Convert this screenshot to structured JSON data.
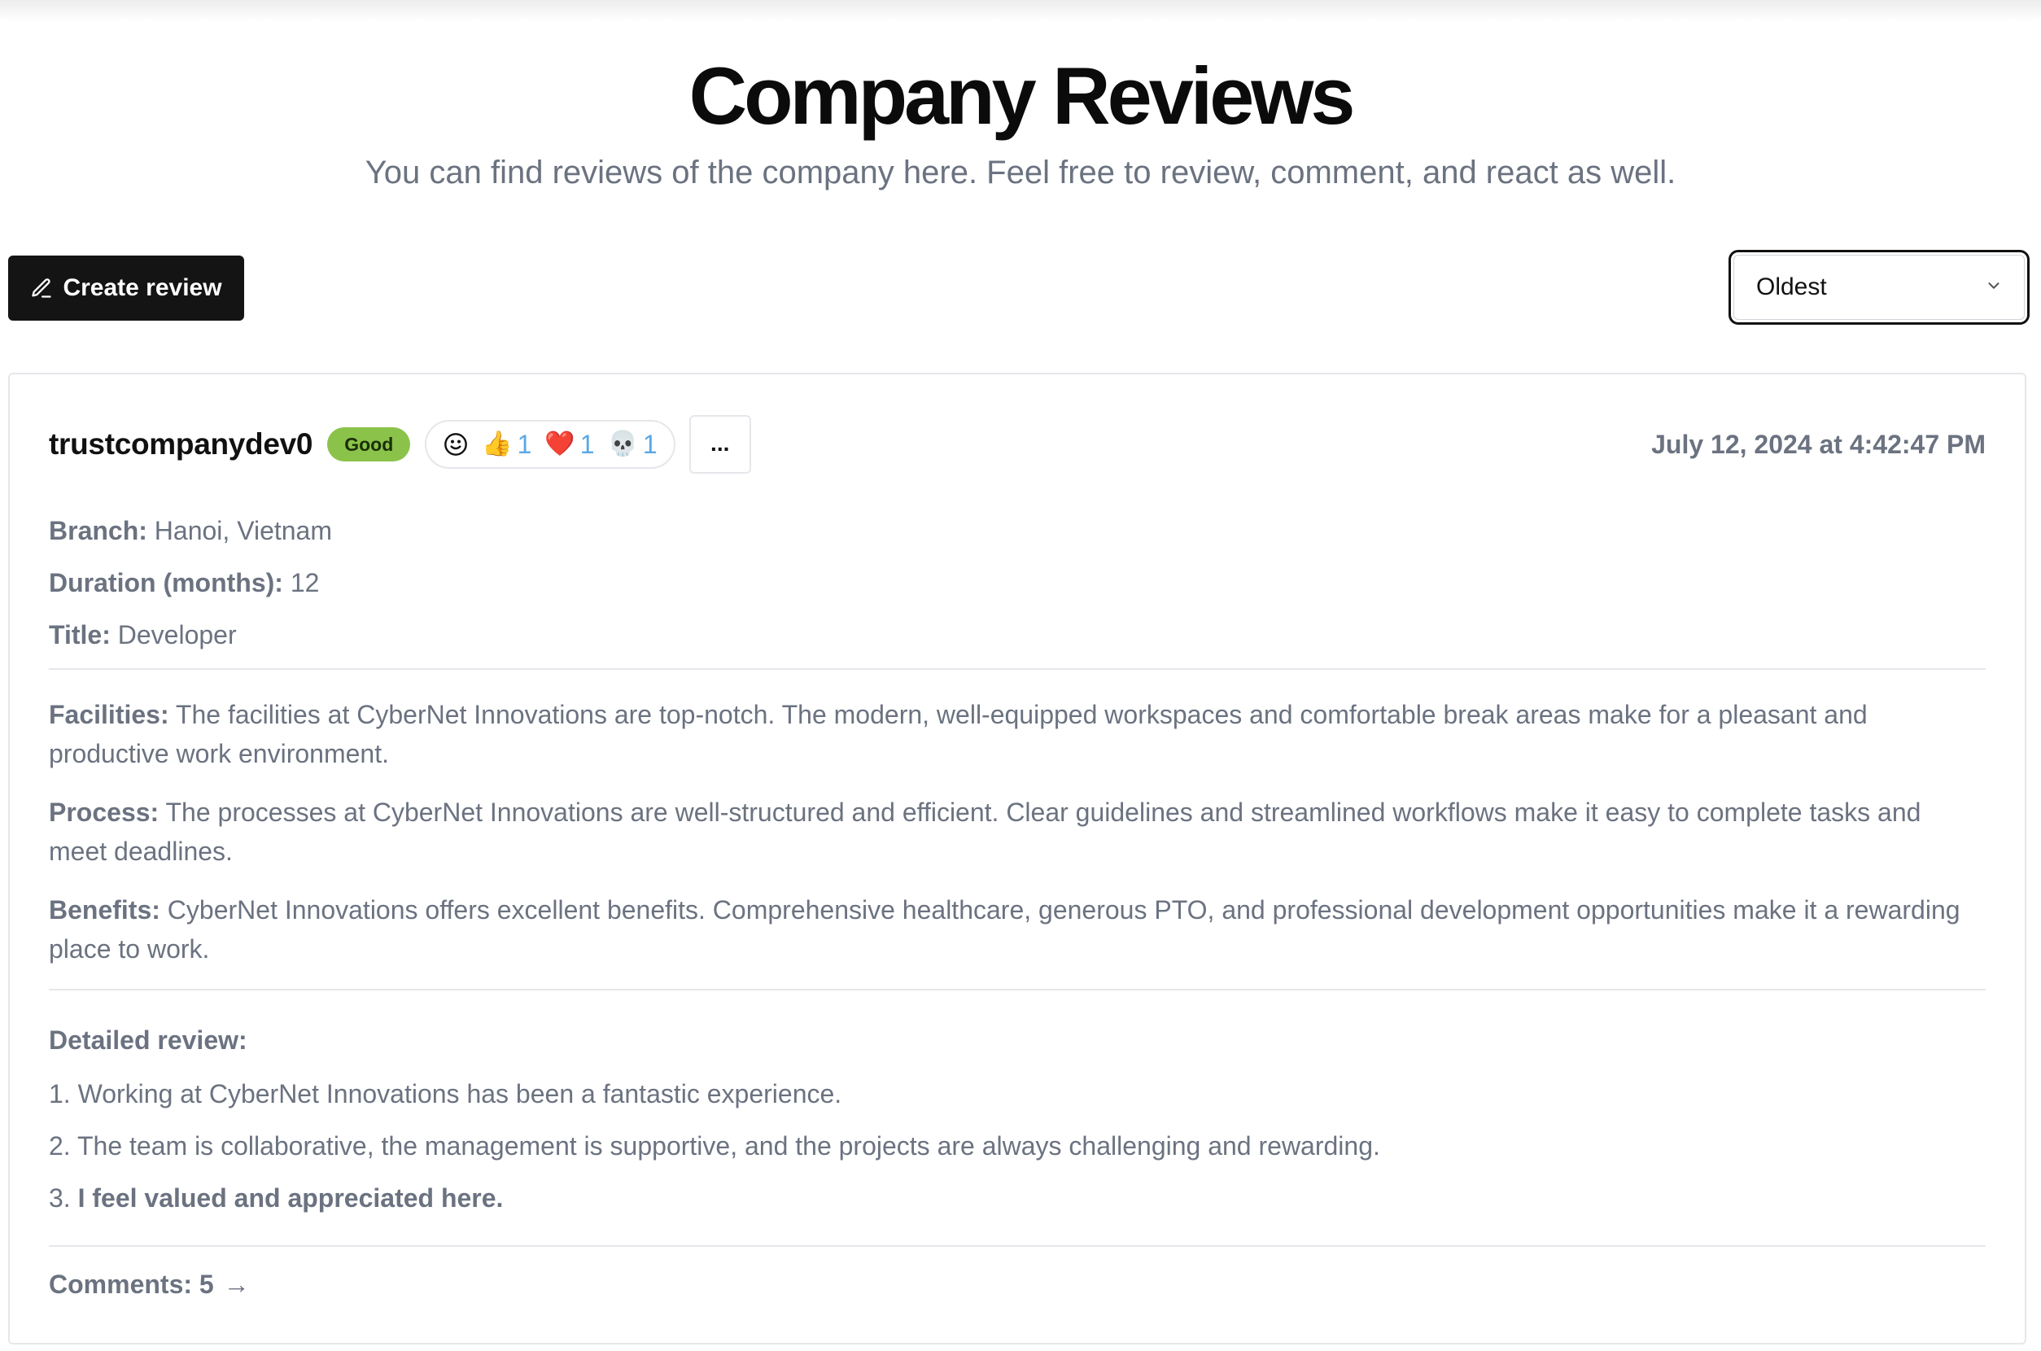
{
  "header": {
    "title": "Company Reviews",
    "subtitle": "You can find reviews of the company here. Feel free to review, comment, and react as well."
  },
  "toolbar": {
    "create_label": "Create review",
    "sort_value": "Oldest"
  },
  "review": {
    "username": "trustcompanydev0",
    "rating_badge": "Good",
    "reactions": [
      {
        "icon": "thumbs-up-icon",
        "emoji": "👍",
        "count": "1"
      },
      {
        "icon": "heart-icon",
        "emoji": "❤️",
        "count": "1"
      },
      {
        "icon": "skull-icon",
        "emoji": "💀",
        "count": "1"
      }
    ],
    "more_label": "...",
    "timestamp": "July 12, 2024 at 4:42:47 PM",
    "branch_label": "Branch:",
    "branch": "Hanoi, Vietnam",
    "duration_label": "Duration (months):",
    "duration": "12",
    "title_label": "Title:",
    "title": "Developer",
    "facilities_label": "Facilities:",
    "facilities": "The facilities at CyberNet Innovations are top-notch. The modern, well-equipped workspaces and comfortable break areas make for a pleasant and productive work environment.",
    "process_label": "Process:",
    "process": "The processes at CyberNet Innovations are well-structured and efficient. Clear guidelines and streamlined workflows make it easy to complete tasks and meet deadlines.",
    "benefits_label": "Benefits:",
    "benefits": "CyberNet Innovations offers excellent benefits. Comprehensive healthcare, generous PTO, and professional development opportunities make it a rewarding place to work.",
    "detailed_label": "Detailed review:",
    "detailed_items": [
      {
        "num": "1.",
        "text": "Working at CyberNet Innovations has been a fantastic experience."
      },
      {
        "num": "2.",
        "text": "The team is collaborative, the management is supportive, and the projects are always challenging and rewarding."
      },
      {
        "num": "3.",
        "text": "I feel valued and appreciated here."
      }
    ],
    "comments_label": "Comments: 5",
    "comments_arrow": "→"
  },
  "colors": {
    "badge_good": "#8bc34a",
    "reaction_count": "#5aa8e6",
    "button_dark": "#141414",
    "muted_text": "#6b7280"
  }
}
